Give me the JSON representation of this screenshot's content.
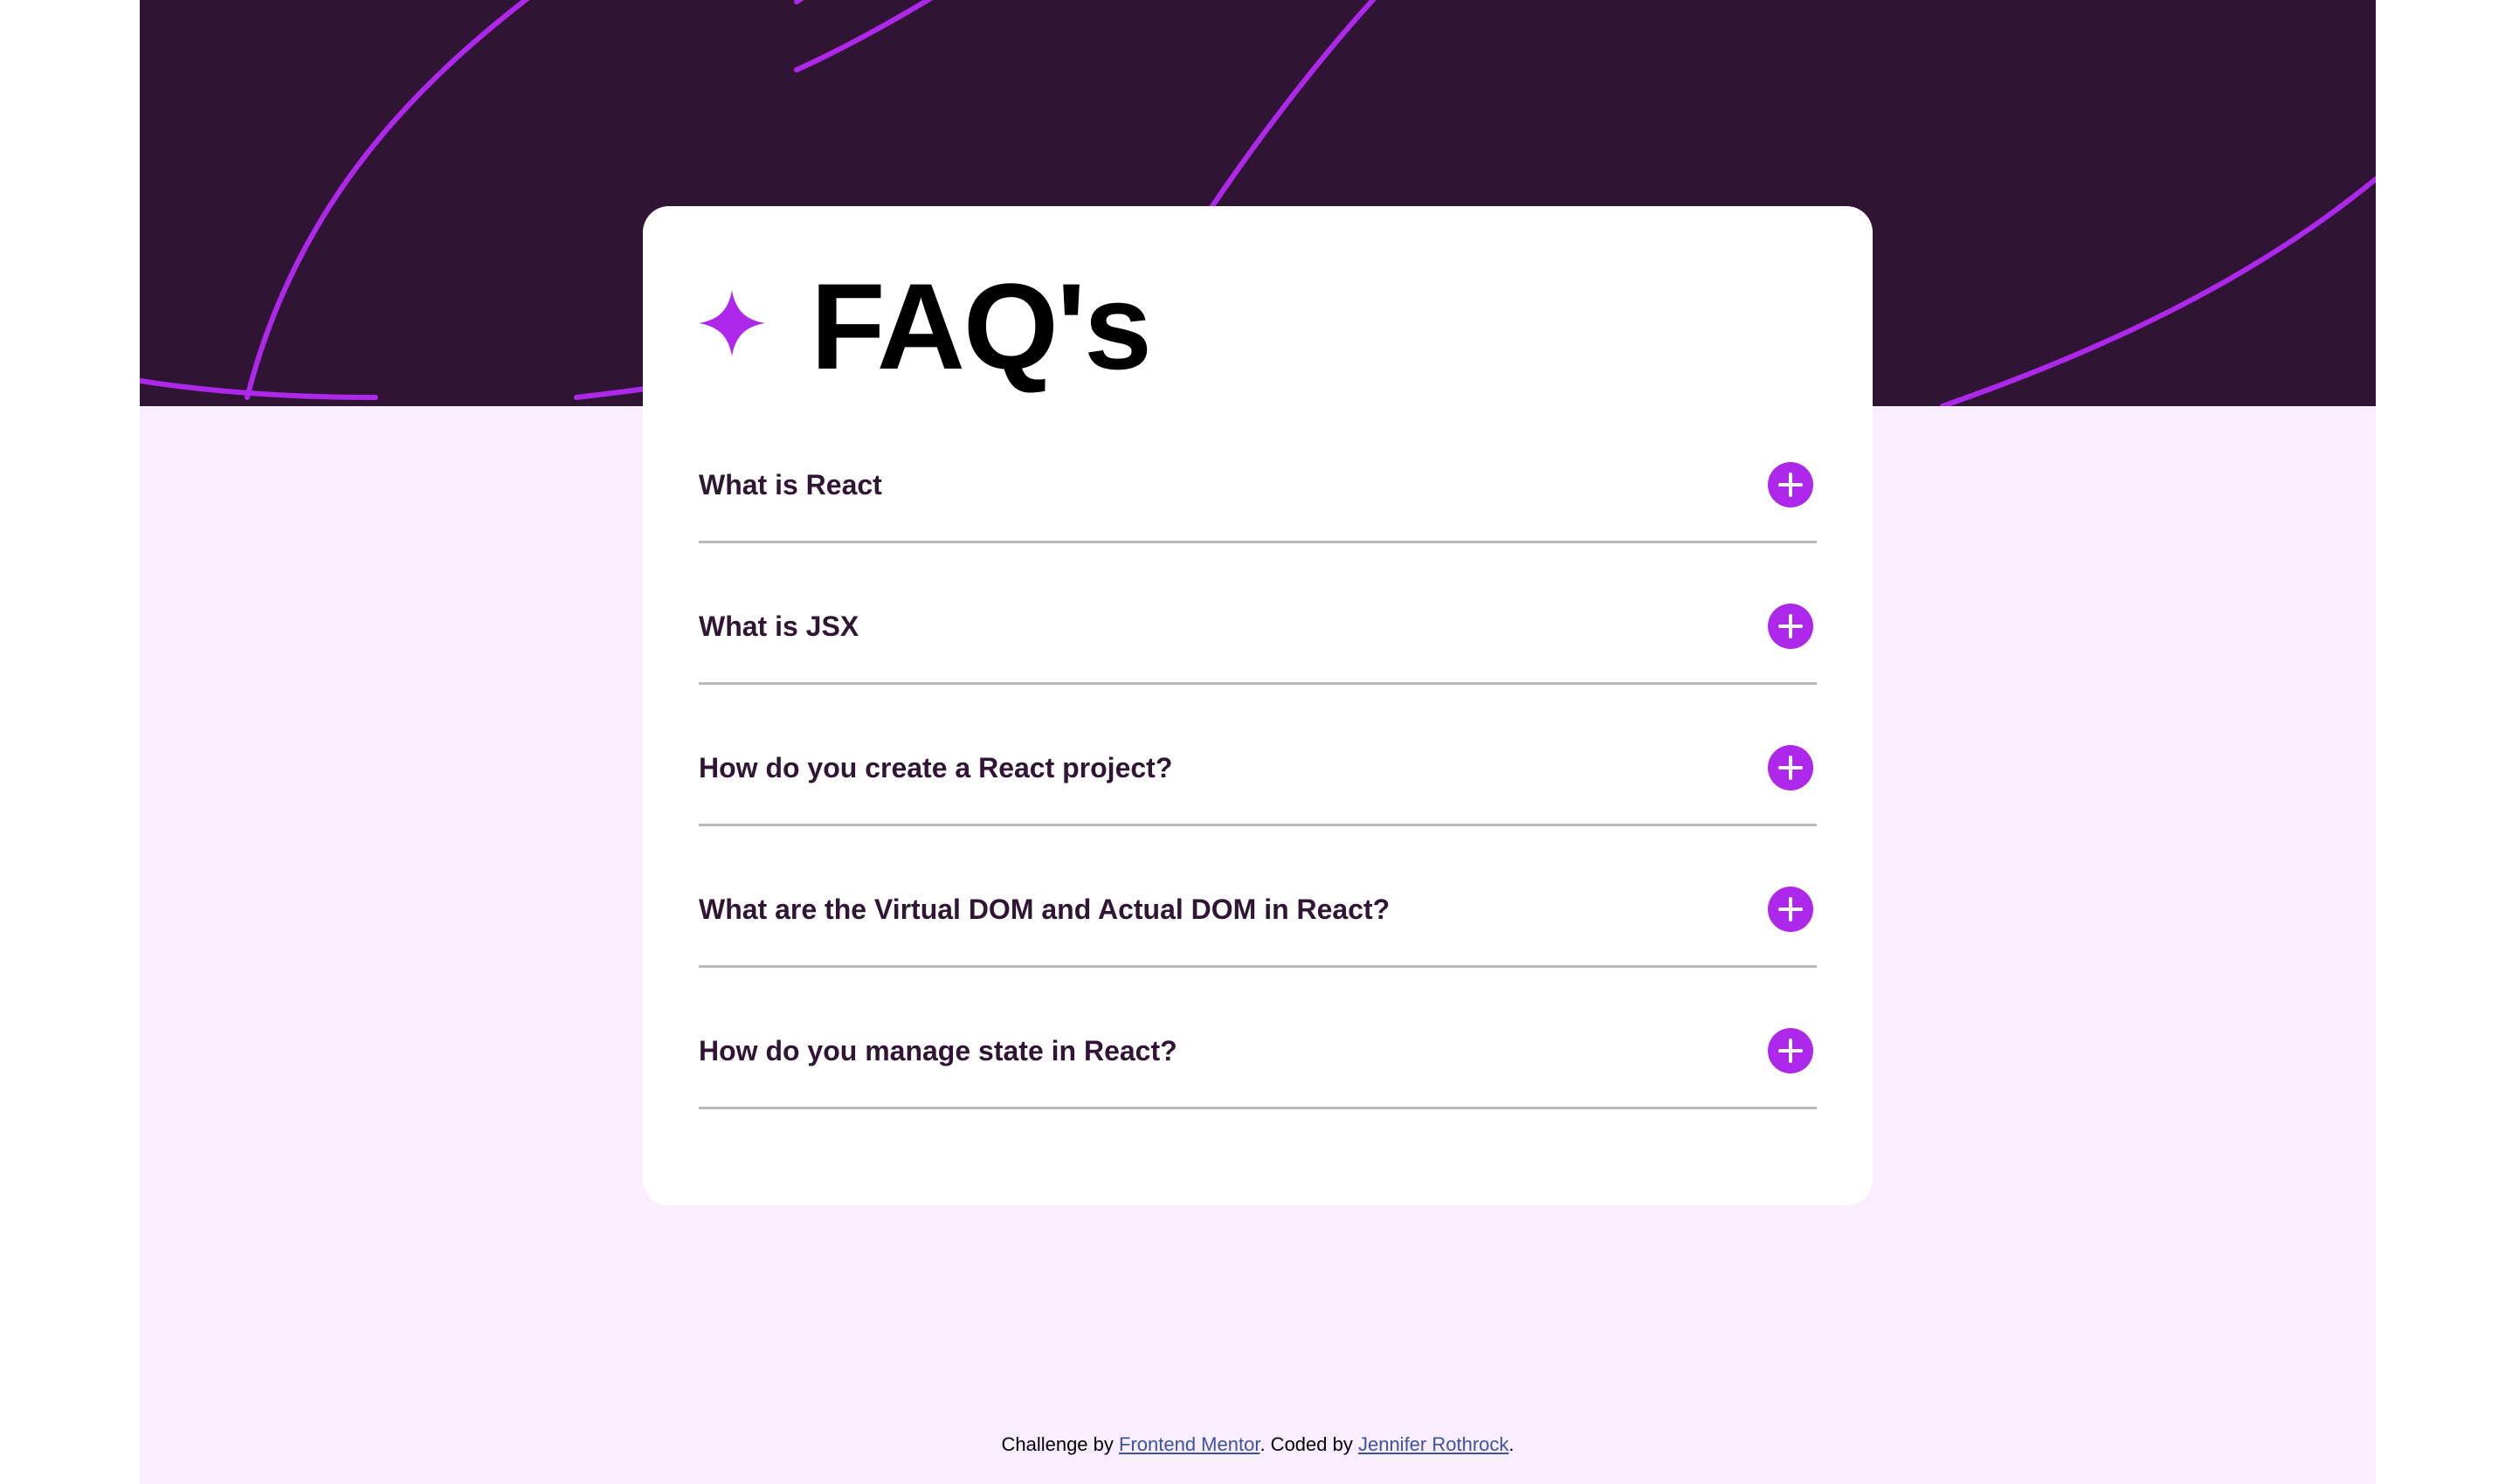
{
  "title": "FAQ's",
  "icon_names": {
    "title_icon": "star-icon",
    "toggle_icon": "plus-icon"
  },
  "colors": {
    "hero_background": "#2f1533",
    "page_background": "#f8eeff",
    "accent_purple": "#ad28eb",
    "question_text": "#301534",
    "link": "#3e52a3"
  },
  "faqs": [
    {
      "question": "What is React"
    },
    {
      "question": "What is JSX"
    },
    {
      "question": "How do you create a React project?"
    },
    {
      "question": "What are the Virtual DOM and Actual DOM in React?"
    },
    {
      "question": "How do you manage state in React?"
    }
  ],
  "footer": {
    "challenge_prefix": "Challenge by ",
    "challenge_link": "Frontend Mentor",
    "coded_prefix": ". Coded by ",
    "coded_link": "Jennifer Rothrock",
    "suffix": "."
  }
}
